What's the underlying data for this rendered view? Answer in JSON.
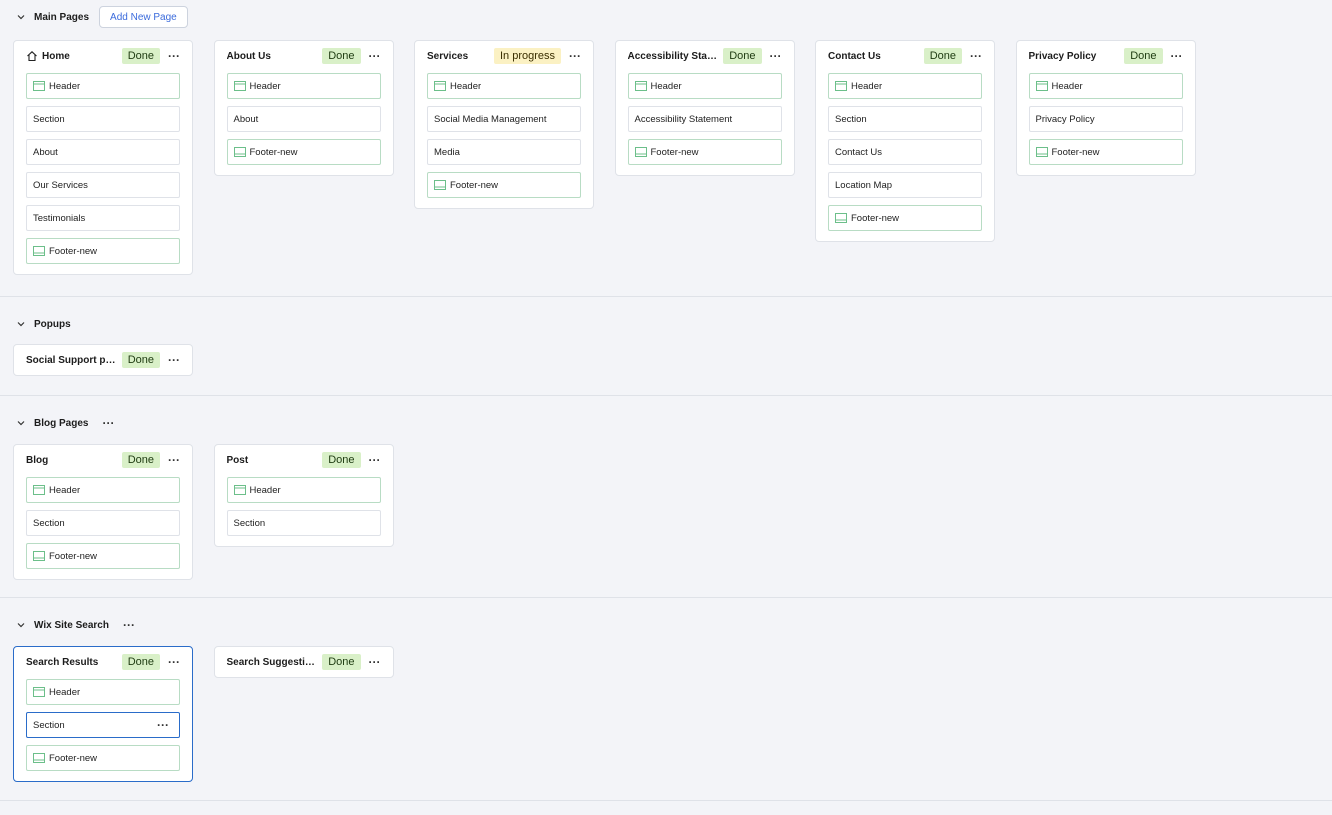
{
  "sections": {
    "main": {
      "title": "Main Pages",
      "add_label": "Add New Page",
      "pages": [
        {
          "title": "Home",
          "status": "Done",
          "items": [
            {
              "label": "Header",
              "master": true
            },
            {
              "label": "Section",
              "master": false
            },
            {
              "label": "About",
              "master": false
            },
            {
              "label": "Our Services",
              "master": false
            },
            {
              "label": "Testimonials",
              "master": false
            },
            {
              "label": "Footer-new",
              "master": true
            }
          ]
        },
        {
          "title": "About Us",
          "status": "Done",
          "items": [
            {
              "label": "Header",
              "master": true
            },
            {
              "label": "About",
              "master": false
            },
            {
              "label": "Footer-new",
              "master": true
            }
          ]
        },
        {
          "title": "Services",
          "status": "In progress",
          "items": [
            {
              "label": "Header",
              "master": true
            },
            {
              "label": "Social Media Management",
              "master": false
            },
            {
              "label": "Media",
              "master": false
            },
            {
              "label": "Footer-new",
              "master": true
            }
          ]
        },
        {
          "title": "Accessibility State...",
          "status": "Done",
          "items": [
            {
              "label": "Header",
              "master": true
            },
            {
              "label": "Accessibility Statement",
              "master": false
            },
            {
              "label": "Footer-new",
              "master": true
            }
          ]
        },
        {
          "title": "Contact Us",
          "status": "Done",
          "items": [
            {
              "label": "Header",
              "master": true
            },
            {
              "label": "Section",
              "master": false
            },
            {
              "label": "Contact Us",
              "master": false
            },
            {
              "label": "Location Map",
              "master": false
            },
            {
              "label": "Footer-new",
              "master": true
            }
          ]
        },
        {
          "title": "Privacy Policy",
          "status": "Done",
          "items": [
            {
              "label": "Header",
              "master": true
            },
            {
              "label": "Privacy Policy",
              "master": false
            },
            {
              "label": "Footer-new",
              "master": true
            }
          ]
        }
      ]
    },
    "popups": {
      "title": "Popups",
      "pages": [
        {
          "title": "Social Support pop...",
          "status": "Done",
          "items": []
        }
      ]
    },
    "blog": {
      "title": "Blog Pages",
      "pages": [
        {
          "title": "Blog",
          "status": "Done",
          "items": [
            {
              "label": "Header",
              "master": true
            },
            {
              "label": "Section",
              "master": false
            },
            {
              "label": "Footer-new",
              "master": true
            }
          ]
        },
        {
          "title": "Post",
          "status": "Done",
          "items": [
            {
              "label": "Header",
              "master": true
            },
            {
              "label": "Section",
              "master": false
            }
          ]
        }
      ]
    },
    "search": {
      "title": "Wix Site Search",
      "pages": [
        {
          "title": "Search Results",
          "status": "Done",
          "selected": true,
          "items": [
            {
              "label": "Header",
              "master": true
            },
            {
              "label": "Section",
              "master": false,
              "selected": true
            },
            {
              "label": "Footer-new",
              "master": true
            }
          ]
        },
        {
          "title": "Search Suggestions",
          "status": "Done",
          "items": []
        }
      ]
    }
  },
  "colors": {
    "done_bg": "#d9f0c8",
    "progress_bg": "#fbf1c3",
    "selected_border": "#2a6cc9",
    "master_border": "#b8dcc4",
    "master_icon": "#6cbf8a"
  }
}
